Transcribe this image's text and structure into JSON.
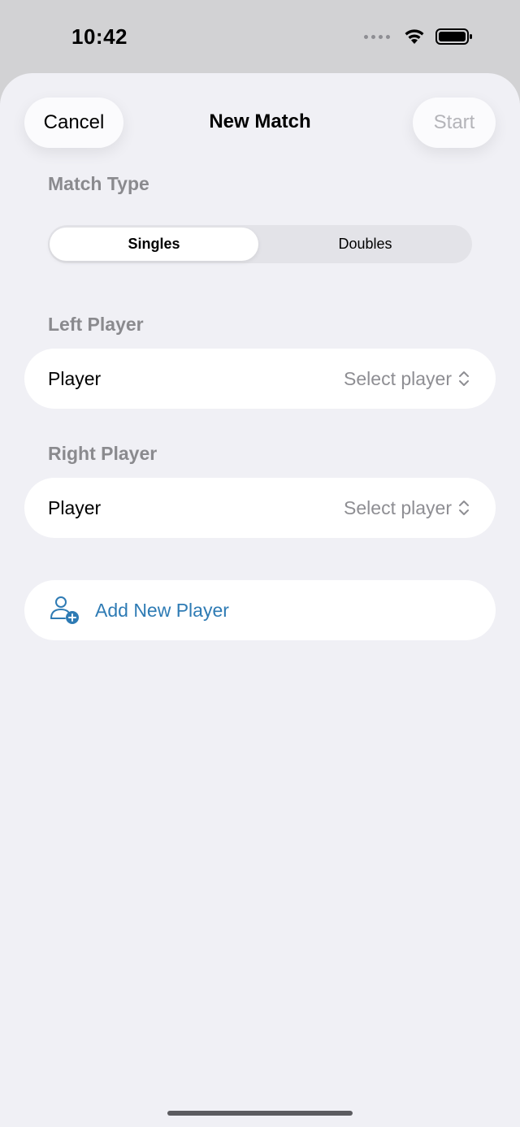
{
  "status_bar": {
    "time": "10:42"
  },
  "nav": {
    "cancel_label": "Cancel",
    "title": "New Match",
    "start_label": "Start"
  },
  "match_type": {
    "label": "Match Type",
    "options": [
      "Singles",
      "Doubles"
    ],
    "selected": "Singles"
  },
  "left_player": {
    "section_label": "Left Player",
    "row_label": "Player",
    "value": "Select player"
  },
  "right_player": {
    "section_label": "Right Player",
    "row_label": "Player",
    "value": "Select player"
  },
  "add_player": {
    "label": "Add New Player",
    "icon": "person-add-icon"
  },
  "colors": {
    "accent": "#2e7bb4",
    "background": "#f0f0f5",
    "secondary_text": "#8a8a8e",
    "disabled_text": "#b4b4b9"
  }
}
